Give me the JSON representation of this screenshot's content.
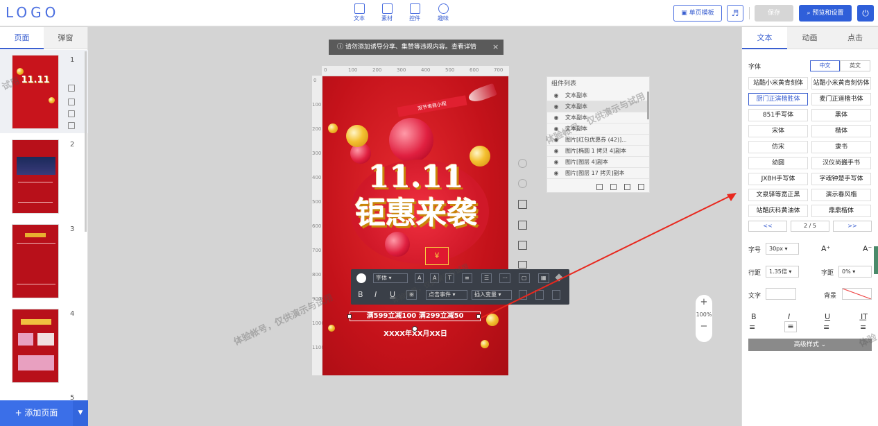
{
  "header": {
    "logo": "LOGO",
    "tools": [
      {
        "label": "文本",
        "icon": "text-icon"
      },
      {
        "label": "素材",
        "icon": "image-icon"
      },
      {
        "label": "控件",
        "icon": "widget-icon"
      },
      {
        "label": "趣味",
        "icon": "bulb-icon"
      }
    ],
    "template_btn": "单页模板",
    "music_icon": "♬",
    "save_btn": "保存",
    "preview_btn": "预览和设置",
    "power_icon": "⏻"
  },
  "left": {
    "tabs": [
      "页面",
      "弹窗"
    ],
    "page_numbers": [
      "1",
      "2",
      "3",
      "4",
      "5"
    ],
    "add_page": "+ 添加页面",
    "add_page_more": "▼"
  },
  "notice": {
    "text": "请勿添加诱导分享、集赞等违规内容。查看详情",
    "close": "×"
  },
  "ruler": {
    "top": [
      "0",
      "100",
      "200",
      "300",
      "400",
      "500",
      "600",
      "700"
    ],
    "left": [
      "0",
      "100",
      "200",
      "300",
      "400",
      "500",
      "600",
      "700",
      "800",
      "900",
      "1000",
      "1100"
    ]
  },
  "poster": {
    "banner": "双节电商小程",
    "title_line1": "11.11",
    "title_line2": "钜惠来袭",
    "text": "满599立减100 满299立减50",
    "date": "XXXX年XX月XX日",
    "coupon": "¥"
  },
  "toolbar": {
    "font": "字体",
    "click_event": "点击事件",
    "insert_var": "插入变量",
    "row1_icons": [
      "A",
      "A",
      "T",
      "≡",
      "☰",
      "⋯",
      "▢",
      "▦"
    ],
    "row2_icons": [
      "B",
      "I",
      "U",
      "⊞"
    ]
  },
  "layers": {
    "title": "组件列表",
    "items": [
      "文本副本",
      "文本副本",
      "文本副本",
      "文本副本",
      "图片[红包优惠券 (42)]...",
      "图片[椭圆 1 拷贝 4]副本",
      "图片[图层 4]副本",
      "图片[图层 17 拷贝]副本"
    ]
  },
  "zoom": {
    "plus": "+",
    "value": "100%",
    "minus": "−"
  },
  "right": {
    "tabs": [
      "文本",
      "动画",
      "点击"
    ],
    "font_label": "字体",
    "lang": [
      "中文",
      "英文"
    ],
    "fonts": [
      "站酷小米黄青刻体",
      "站酷小米黄青刻仿体",
      "厨门正演楷胜体",
      "麦门正道楷书体",
      "851手写体",
      "黑体",
      "宋体",
      "楷体",
      "仿宋",
      "隶书",
      "幼圆",
      "汉仪尚巍手书",
      "JXBH手写体",
      "字魂钟楚手写体",
      "文泉驿等宽正黑",
      "演示春风楷",
      "站酷庆科黄油体",
      "鼎鼎楷体"
    ],
    "pager": {
      "prev": "<<",
      "page": "2 / 5",
      "next": ">>"
    },
    "size_label": "字号",
    "size_value": "30px",
    "line_label": "行距",
    "line_value": "1.35倍",
    "spacing_label": "字距",
    "spacing_value": "0%",
    "text_label": "文字",
    "bg_label": "背景",
    "styles": [
      "B",
      "I",
      "U",
      "I͟T"
    ],
    "aligns": [
      "≡",
      "≡",
      "≡",
      "≡"
    ],
    "adv": "高级样式 ⌄"
  },
  "watermarks": [
    "体验帐号，仅供演示与试用",
    "体验帐号，仅供演示与试用",
    "体验帐号，仅供演示与试用",
    "试用",
    "体验"
  ]
}
